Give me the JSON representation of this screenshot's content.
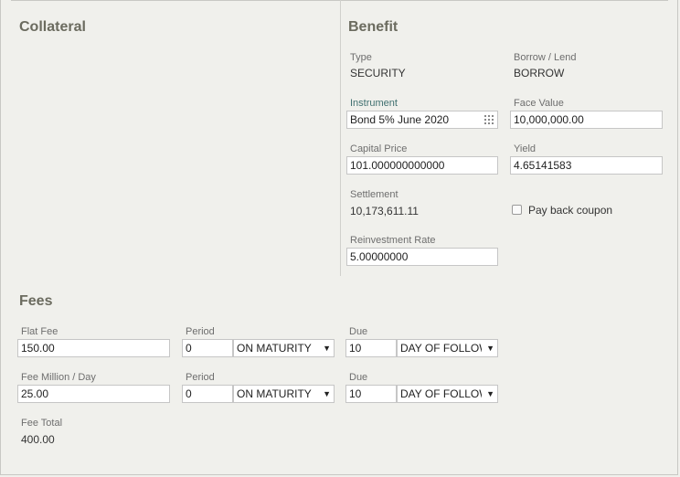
{
  "collateral": {
    "title": "Collateral"
  },
  "benefit": {
    "title": "Benefit",
    "type": {
      "label": "Type",
      "value": "SECURITY"
    },
    "borrow_lend": {
      "label": "Borrow / Lend",
      "value": "BORROW"
    },
    "instrument": {
      "label": "Instrument",
      "value": "Bond 5% June 2020",
      "icon": "grid-icon"
    },
    "face_value": {
      "label": "Face Value",
      "value": "10,000,000.00"
    },
    "capital_price": {
      "label": "Capital Price",
      "value": "101.000000000000"
    },
    "yield": {
      "label": "Yield",
      "value": "4.65141583"
    },
    "settlement": {
      "label": "Settlement",
      "value": "10,173,611.11"
    },
    "pay_back_coupon": {
      "label": "Pay back coupon",
      "checked": false
    },
    "reinvestment_rate": {
      "label": "Reinvestment Rate",
      "value": "5.00000000"
    }
  },
  "fees": {
    "title": "Fees",
    "rows": [
      {
        "fee_label": "Flat Fee",
        "fee_value": "150.00",
        "period_label": "Period",
        "period_value": "0",
        "period_option": "ON MATURITY",
        "due_label": "Due",
        "due_value": "10",
        "due_option": "DAY OF FOLLOWING"
      },
      {
        "fee_label": "Fee Million / Day",
        "fee_value": "25.00",
        "period_label": "Period",
        "period_value": "0",
        "period_option": "ON MATURITY",
        "due_label": "Due",
        "due_value": "10",
        "due_option": "DAY OF FOLLOWING"
      }
    ],
    "total": {
      "label": "Fee Total",
      "value": "400.00"
    }
  },
  "colors": {
    "background": "#f0f0ec",
    "section_title": "#6b6b5f",
    "instrument_label": "#3f6f6f"
  }
}
